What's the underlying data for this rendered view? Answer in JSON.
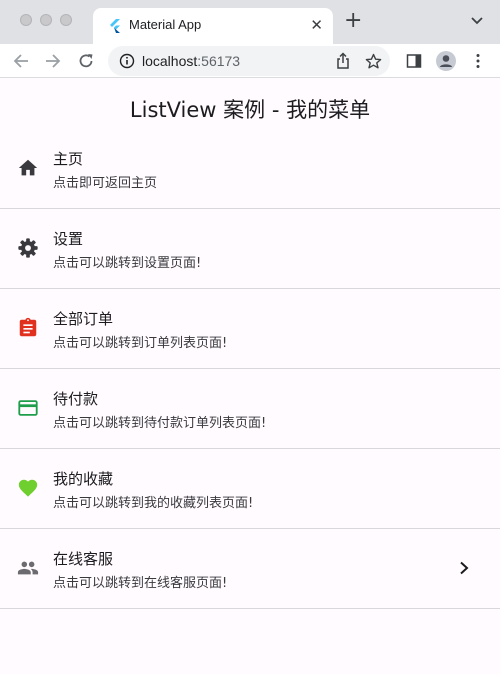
{
  "browser": {
    "tab_title": "Material App",
    "tab_close": "✕",
    "new_tab": "+",
    "url_host": "localhost",
    "url_port": ":56173"
  },
  "page": {
    "title": "ListView 案例 - 我的菜单"
  },
  "menu": {
    "items": [
      {
        "title": "主页",
        "subtitle": "点击即可返回主页",
        "icon": "home-icon",
        "icon_color": "#3a3a3e"
      },
      {
        "title": "设置",
        "subtitle": "点击可以跳转到设置页面!",
        "icon": "settings-icon",
        "icon_color": "#3a3a3e"
      },
      {
        "title": "全部订单",
        "subtitle": "点击可以跳转到订单列表页面!",
        "icon": "assignment-icon",
        "icon_color": "#e0301e"
      },
      {
        "title": "待付款",
        "subtitle": "点击可以跳转到待付款订单列表页面!",
        "icon": "payment-card-icon",
        "icon_color": "#1e9e4a"
      },
      {
        "title": "我的收藏",
        "subtitle": "点击可以跳转到我的收藏列表页面!",
        "icon": "favorite-icon",
        "icon_color": "#6fcf2e"
      },
      {
        "title": "在线客服",
        "subtitle": "点击可以跳转到在线客服页面!",
        "icon": "people-icon",
        "icon_color": "#6b6b70",
        "trailing": "chevron-right-icon"
      }
    ]
  }
}
